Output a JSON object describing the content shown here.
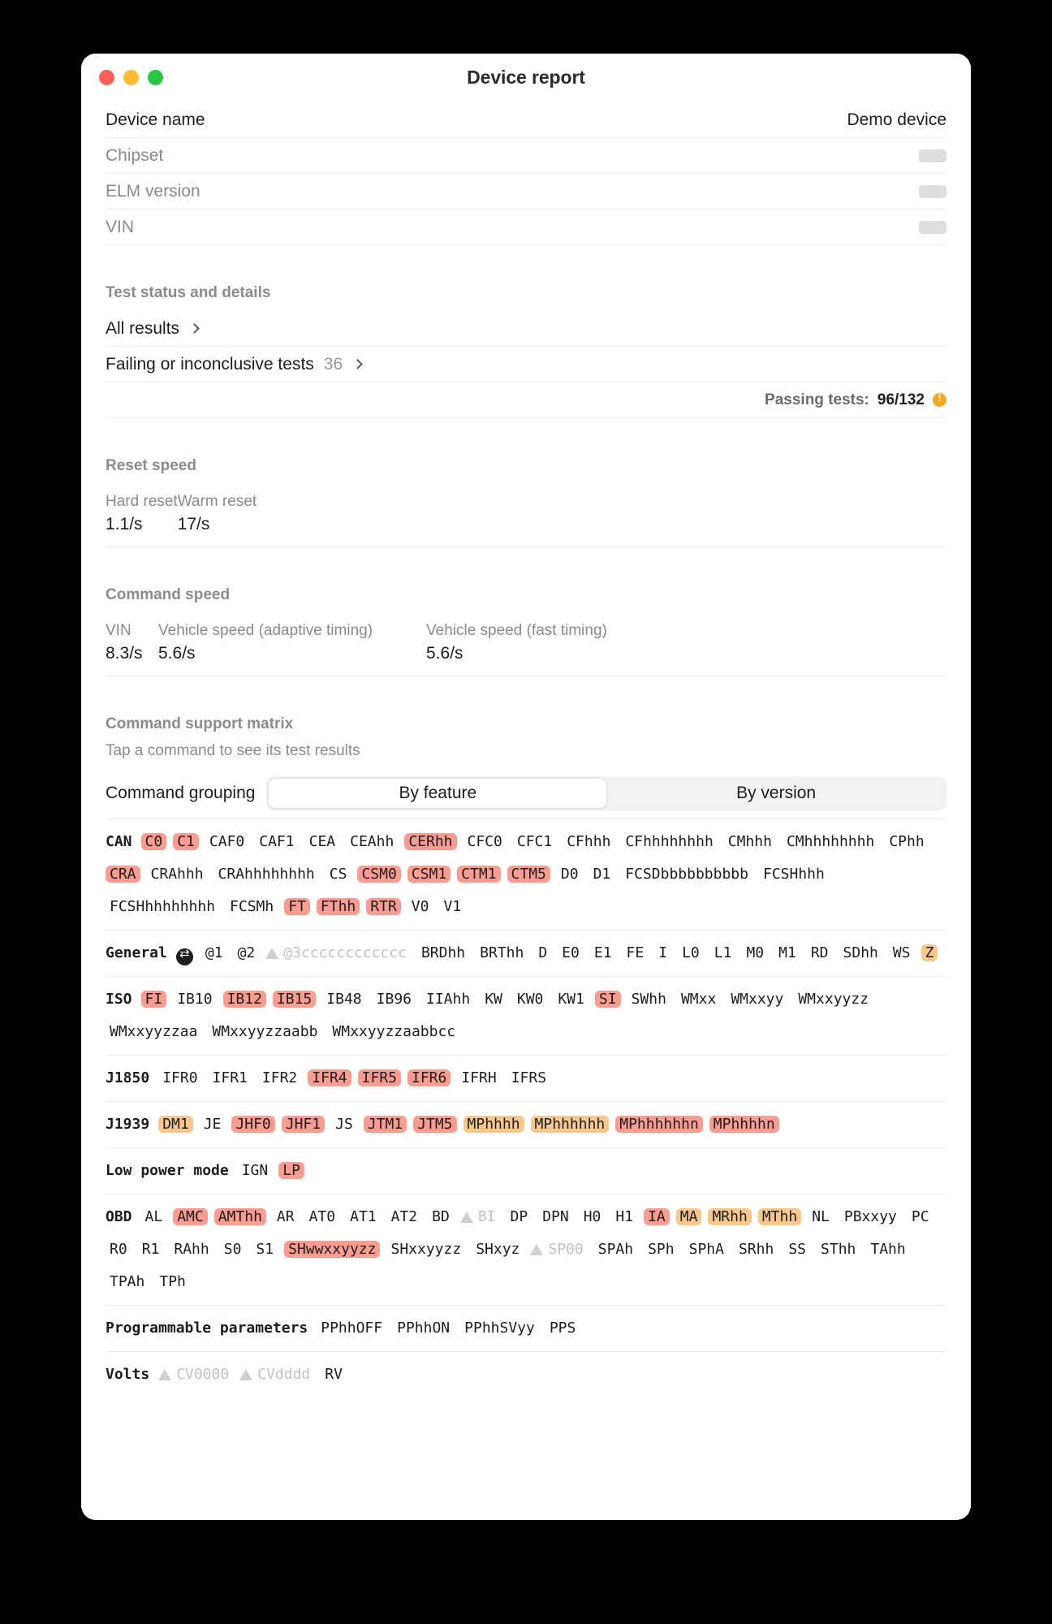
{
  "window": {
    "title": "Device report",
    "traffic_lights": [
      "close-red",
      "minimize-yellow",
      "maximize-green"
    ]
  },
  "device_info": {
    "rows": [
      {
        "label": "Device name",
        "value": "Demo device",
        "muted": false,
        "placeholder": false
      },
      {
        "label": "Chipset",
        "value": "",
        "muted": true,
        "placeholder": true
      },
      {
        "label": "ELM version",
        "value": "",
        "muted": true,
        "placeholder": true
      },
      {
        "label": "VIN",
        "value": "",
        "muted": true,
        "placeholder": true
      }
    ]
  },
  "test_status": {
    "section_title": "Test status and details",
    "all_results_label": "All results",
    "failing_label": "Failing or inconclusive tests",
    "failing_count": "36",
    "passing_label": "Passing tests:",
    "passing_value": "96/132"
  },
  "reset_speed": {
    "section_title": "Reset speed",
    "metrics": [
      {
        "label": "Hard reset",
        "value": "1.1/s"
      },
      {
        "label": "Warm reset",
        "value": "17/s"
      }
    ]
  },
  "command_speed": {
    "section_title": "Command speed",
    "metrics": [
      {
        "label": "VIN",
        "value": "8.3/s"
      },
      {
        "label": "Vehicle speed (adaptive timing)",
        "value": "5.6/s"
      },
      {
        "label": "Vehicle speed (fast timing)",
        "value": "5.6/s"
      }
    ]
  },
  "command_matrix": {
    "section_title": "Command support matrix",
    "section_sub": "Tap a command to see its test results",
    "grouping_label": "Command grouping",
    "segments": [
      {
        "label": "By feature",
        "active": true
      },
      {
        "label": "By version",
        "active": false
      }
    ],
    "colors": {
      "red": "#fa9c90",
      "orange": "#f8c78c",
      "dim": "#c2c2c2"
    },
    "groups": [
      {
        "name": "CAN",
        "commands": [
          {
            "t": "C0",
            "s": "red"
          },
          {
            "t": "C1",
            "s": "red"
          },
          {
            "t": "CAF0",
            "s": "plain"
          },
          {
            "t": "CAF1",
            "s": "plain"
          },
          {
            "t": "CEA",
            "s": "plain"
          },
          {
            "t": "CEAhh",
            "s": "plain"
          },
          {
            "t": "CERhh",
            "s": "red"
          },
          {
            "t": "CFC0",
            "s": "plain"
          },
          {
            "t": "CFC1",
            "s": "plain"
          },
          {
            "t": "CFhhh",
            "s": "plain"
          },
          {
            "t": "CFhhhhhhhh",
            "s": "plain"
          },
          {
            "t": "CMhhh",
            "s": "plain"
          },
          {
            "t": "CMhhhhhhhh",
            "s": "plain"
          },
          {
            "t": "CPhh",
            "s": "plain"
          },
          {
            "t": "CRA",
            "s": "red"
          },
          {
            "t": "CRAhhh",
            "s": "plain"
          },
          {
            "t": "CRAhhhhhhhh",
            "s": "plain"
          },
          {
            "t": "CS",
            "s": "plain"
          },
          {
            "t": "CSM0",
            "s": "red"
          },
          {
            "t": "CSM1",
            "s": "red"
          },
          {
            "t": "CTM1",
            "s": "red"
          },
          {
            "t": "CTM5",
            "s": "red"
          },
          {
            "t": "D0",
            "s": "plain"
          },
          {
            "t": "D1",
            "s": "plain"
          },
          {
            "t": "FCSDbbbbbbbbbb",
            "s": "plain"
          },
          {
            "t": "FCSHhhh",
            "s": "plain"
          },
          {
            "t": "FCSHhhhhhhhh",
            "s": "plain"
          },
          {
            "t": "FCSMh",
            "s": "plain"
          },
          {
            "t": "FT",
            "s": "red"
          },
          {
            "t": "FThh",
            "s": "red"
          },
          {
            "t": "RTR",
            "s": "red"
          },
          {
            "t": "V0",
            "s": "plain"
          },
          {
            "t": "V1",
            "s": "plain"
          }
        ]
      },
      {
        "name": "General",
        "commands": [
          {
            "t": "",
            "s": "icon-cycle"
          },
          {
            "t": "@1",
            "s": "plain"
          },
          {
            "t": "@2",
            "s": "plain"
          },
          {
            "t": "@3cccccccccccc",
            "s": "dim",
            "warn": true
          },
          {
            "t": "BRDhh",
            "s": "plain"
          },
          {
            "t": "BRThh",
            "s": "plain"
          },
          {
            "t": "D",
            "s": "plain"
          },
          {
            "t": "E0",
            "s": "plain"
          },
          {
            "t": "E1",
            "s": "plain"
          },
          {
            "t": "FE",
            "s": "plain"
          },
          {
            "t": "I",
            "s": "plain"
          },
          {
            "t": "L0",
            "s": "plain"
          },
          {
            "t": "L1",
            "s": "plain"
          },
          {
            "t": "M0",
            "s": "plain"
          },
          {
            "t": "M1",
            "s": "plain"
          },
          {
            "t": "RD",
            "s": "plain"
          },
          {
            "t": "SDhh",
            "s": "plain"
          },
          {
            "t": "WS",
            "s": "plain"
          },
          {
            "t": "Z",
            "s": "orange"
          }
        ]
      },
      {
        "name": "ISO",
        "commands": [
          {
            "t": "FI",
            "s": "red"
          },
          {
            "t": "IB10",
            "s": "plain"
          },
          {
            "t": "IB12",
            "s": "red"
          },
          {
            "t": "IB15",
            "s": "red"
          },
          {
            "t": "IB48",
            "s": "plain"
          },
          {
            "t": "IB96",
            "s": "plain"
          },
          {
            "t": "IIAhh",
            "s": "plain"
          },
          {
            "t": "KW",
            "s": "plain"
          },
          {
            "t": "KW0",
            "s": "plain"
          },
          {
            "t": "KW1",
            "s": "plain"
          },
          {
            "t": "SI",
            "s": "red"
          },
          {
            "t": "SWhh",
            "s": "plain"
          },
          {
            "t": "WMxx",
            "s": "plain"
          },
          {
            "t": "WMxxyy",
            "s": "plain"
          },
          {
            "t": "WMxxyyzz",
            "s": "plain"
          },
          {
            "t": "WMxxyyzzaa",
            "s": "plain"
          },
          {
            "t": "WMxxyyzzaabb",
            "s": "plain"
          },
          {
            "t": "WMxxyyzzaabbcc",
            "s": "plain"
          }
        ]
      },
      {
        "name": "J1850",
        "commands": [
          {
            "t": "IFR0",
            "s": "plain"
          },
          {
            "t": "IFR1",
            "s": "plain"
          },
          {
            "t": "IFR2",
            "s": "plain"
          },
          {
            "t": "IFR4",
            "s": "red"
          },
          {
            "t": "IFR5",
            "s": "red"
          },
          {
            "t": "IFR6",
            "s": "red"
          },
          {
            "t": "IFRH",
            "s": "plain"
          },
          {
            "t": "IFRS",
            "s": "plain"
          }
        ]
      },
      {
        "name": "J1939",
        "commands": [
          {
            "t": "DM1",
            "s": "orange"
          },
          {
            "t": "JE",
            "s": "plain"
          },
          {
            "t": "JHF0",
            "s": "red"
          },
          {
            "t": "JHF1",
            "s": "red"
          },
          {
            "t": "JS",
            "s": "plain"
          },
          {
            "t": "JTM1",
            "s": "red"
          },
          {
            "t": "JTM5",
            "s": "red"
          },
          {
            "t": "MPhhhh",
            "s": "orange"
          },
          {
            "t": "MPhhhhhh",
            "s": "orange"
          },
          {
            "t": "MPhhhhhhn",
            "s": "red"
          },
          {
            "t": "MPhhhhn",
            "s": "red"
          }
        ]
      },
      {
        "name": "Low power mode",
        "commands": [
          {
            "t": "IGN",
            "s": "plain"
          },
          {
            "t": "LP",
            "s": "red"
          }
        ]
      },
      {
        "name": "OBD",
        "commands": [
          {
            "t": "AL",
            "s": "plain"
          },
          {
            "t": "AMC",
            "s": "red"
          },
          {
            "t": "AMThh",
            "s": "red"
          },
          {
            "t": "AR",
            "s": "plain"
          },
          {
            "t": "AT0",
            "s": "plain"
          },
          {
            "t": "AT1",
            "s": "plain"
          },
          {
            "t": "AT2",
            "s": "plain"
          },
          {
            "t": "BD",
            "s": "plain"
          },
          {
            "t": "BI",
            "s": "dim",
            "warn": true
          },
          {
            "t": "DP",
            "s": "plain"
          },
          {
            "t": "DPN",
            "s": "plain"
          },
          {
            "t": "H0",
            "s": "plain"
          },
          {
            "t": "H1",
            "s": "plain"
          },
          {
            "t": "IA",
            "s": "red"
          },
          {
            "t": "MA",
            "s": "orange"
          },
          {
            "t": "MRhh",
            "s": "orange"
          },
          {
            "t": "MThh",
            "s": "orange"
          },
          {
            "t": "NL",
            "s": "plain"
          },
          {
            "t": "PBxxyy",
            "s": "plain"
          },
          {
            "t": "PC",
            "s": "plain"
          },
          {
            "t": "R0",
            "s": "plain"
          },
          {
            "t": "R1",
            "s": "plain"
          },
          {
            "t": "RAhh",
            "s": "plain"
          },
          {
            "t": "S0",
            "s": "plain"
          },
          {
            "t": "S1",
            "s": "plain"
          },
          {
            "t": "SHwwxxyyzz",
            "s": "red"
          },
          {
            "t": "SHxxyyzz",
            "s": "plain"
          },
          {
            "t": "SHxyz",
            "s": "plain"
          },
          {
            "t": "SP00",
            "s": "dim",
            "warn": true
          },
          {
            "t": "SPAh",
            "s": "plain"
          },
          {
            "t": "SPh",
            "s": "plain"
          },
          {
            "t": "SPhA",
            "s": "plain"
          },
          {
            "t": "SRhh",
            "s": "plain"
          },
          {
            "t": "SS",
            "s": "plain"
          },
          {
            "t": "SThh",
            "s": "plain"
          },
          {
            "t": "TAhh",
            "s": "plain"
          },
          {
            "t": "TPAh",
            "s": "plain"
          },
          {
            "t": "TPh",
            "s": "plain"
          }
        ]
      },
      {
        "name": "Programmable parameters",
        "commands": [
          {
            "t": "PPhhOFF",
            "s": "plain"
          },
          {
            "t": "PPhhON",
            "s": "plain"
          },
          {
            "t": "PPhhSVyy",
            "s": "plain"
          },
          {
            "t": "PPS",
            "s": "plain"
          }
        ]
      },
      {
        "name": "Volts",
        "commands": [
          {
            "t": "CV0000",
            "s": "dim",
            "warn": true
          },
          {
            "t": "CVdddd",
            "s": "dim",
            "warn": true
          },
          {
            "t": "RV",
            "s": "plain"
          }
        ]
      }
    ]
  }
}
